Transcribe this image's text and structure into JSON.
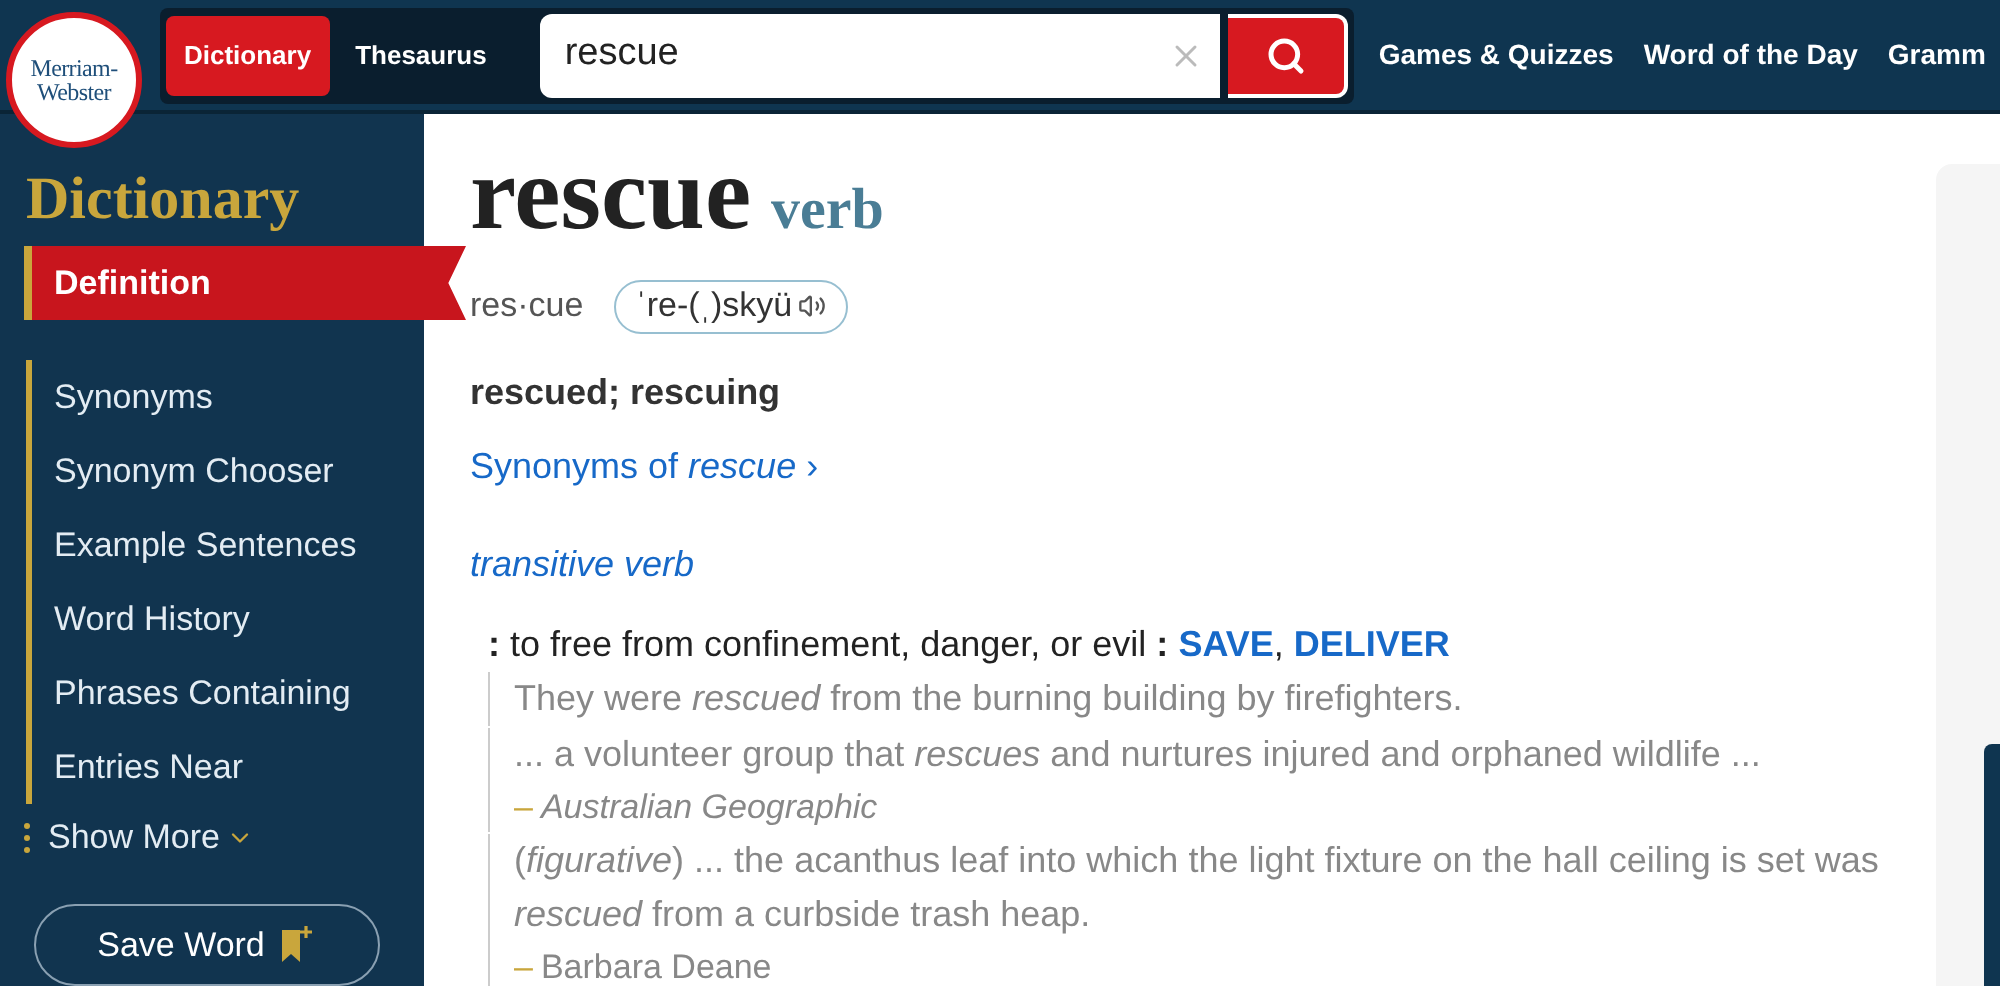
{
  "header": {
    "logo": [
      "Merriam-",
      "Webster"
    ],
    "tabs": [
      {
        "label": "Dictionary",
        "selected": true
      },
      {
        "label": "Thesaurus",
        "selected": false
      }
    ],
    "search": {
      "value": "rescue"
    },
    "nav": [
      "Games & Quizzes",
      "Word of the Day",
      "Gramm"
    ]
  },
  "sidebar": {
    "title": "Dictionary",
    "items": [
      {
        "label": "Definition",
        "selected": true
      },
      {
        "label": "Synonyms",
        "selected": false
      },
      {
        "label": "Synonym Chooser",
        "selected": false
      },
      {
        "label": "Example Sentences",
        "selected": false
      },
      {
        "label": "Word History",
        "selected": false
      },
      {
        "label": "Phrases Containing",
        "selected": false
      },
      {
        "label": "Entries Near",
        "selected": false
      }
    ],
    "show_more": "Show More",
    "save_word": "Save Word"
  },
  "entry": {
    "headword": "rescue",
    "part_of_speech": "verb",
    "syllables": "res·cue",
    "pronunciation": "ˈre-(ˌ)skyü",
    "inflections": "rescued; rescuing",
    "synonyms_link": "Synonyms of *rescue*",
    "synonyms_chevron": "›",
    "sense_label": "transitive verb",
    "definition": {
      "text": "**:** to free from confinement, danger, or evil **:**",
      "synonyms": [
        "SAVE",
        "DELIVER"
      ],
      "separator": ","
    },
    "source_dash": "–",
    "examples": [
      {
        "text": "They were *rescued* from the burning building by firefighters."
      },
      {
        "text": "... a volunteer group that *rescues* and nurtures injured and orphaned wildlife ...",
        "source": "Australian Geographic",
        "source_italic": true
      },
      {
        "text": "(*figurative*) ... the acanthus leaf into which the light fixture on the hall ceiling is set was *rescued* from a curbside trash heap.",
        "source": "Barbara Deane",
        "source_italic": false
      }
    ]
  }
}
